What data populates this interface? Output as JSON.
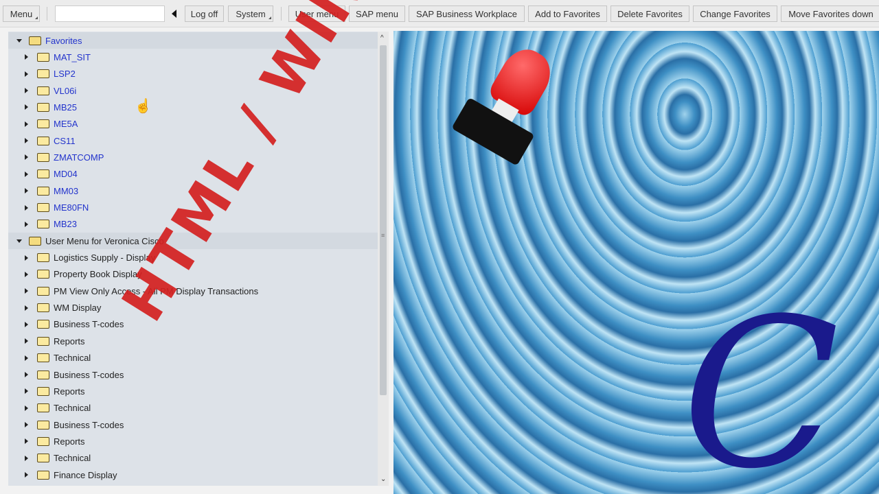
{
  "toolbar": {
    "menu": "Menu",
    "command_value": "",
    "logoff": "Log off",
    "system": "System",
    "user_menu": "User menu",
    "sap_menu": "SAP menu",
    "workplace": "SAP Business Workplace",
    "add_fav": "Add to Favorites",
    "del_fav": "Delete Favorites",
    "change_fav": "Change Favorites",
    "move_down": "Move Favorites down"
  },
  "tree": {
    "favorites": {
      "label": "Favorites",
      "items": [
        "MAT_SIT",
        "LSP2",
        "VL06i",
        "MB25",
        "ME5A",
        "CS11",
        "ZMATCOMP",
        "MD04",
        "MM03",
        "ME80FN",
        "MB23"
      ]
    },
    "user_menu": {
      "label": "User Menu for Veronica Cisco",
      "items": [
        "Logistics Supply - Display",
        "Property Book Display",
        " PM View Only Access - All PM Display Transactions",
        "WM  Display",
        "Business T-codes",
        "Reports",
        "Technical",
        "Business T-codes",
        "Reports",
        "Technical",
        "Business T-codes",
        "Reports",
        "Technical",
        "Finance Display"
      ]
    }
  },
  "overlay": {
    "watermark": "HTML / WIN GUI",
    "logo": "C"
  },
  "colors": {
    "favorite_link": "#2233cc",
    "watermark": "#d42020",
    "logo": "#1a1a8c"
  }
}
